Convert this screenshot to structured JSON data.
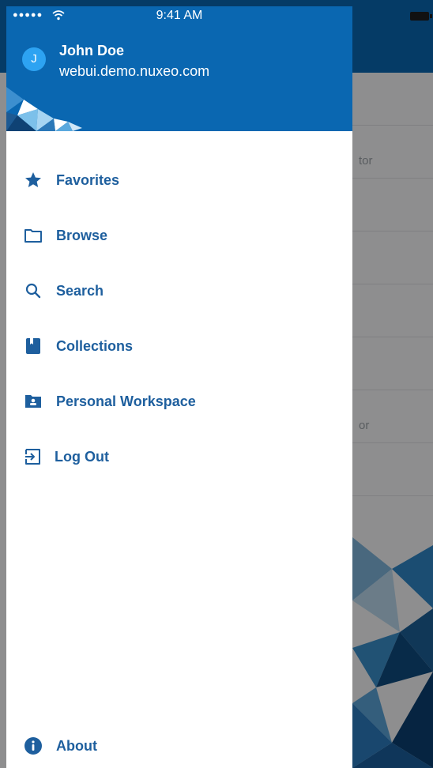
{
  "status_bar": {
    "signal": "●●●●●",
    "time": "9:41 AM"
  },
  "user": {
    "initial": "J",
    "name": "John Doe",
    "host": "webui.demo.nuxeo.com"
  },
  "menu": {
    "items": [
      {
        "label": "Favorites",
        "icon": "star-icon"
      },
      {
        "label": "Browse",
        "icon": "folder-icon"
      },
      {
        "label": "Search",
        "icon": "search-icon"
      },
      {
        "label": "Collections",
        "icon": "bookmark-icon"
      },
      {
        "label": "Personal Workspace",
        "icon": "person-folder-icon"
      },
      {
        "label": "Log Out",
        "icon": "logout-icon"
      }
    ],
    "about": {
      "label": "About",
      "icon": "info-icon"
    }
  },
  "background": {
    "row_fragments": [
      "tor",
      "or"
    ]
  },
  "colors": {
    "brand": "#0a67b1",
    "menu_text": "#1e5f9e",
    "avatar": "#2da3f2"
  }
}
